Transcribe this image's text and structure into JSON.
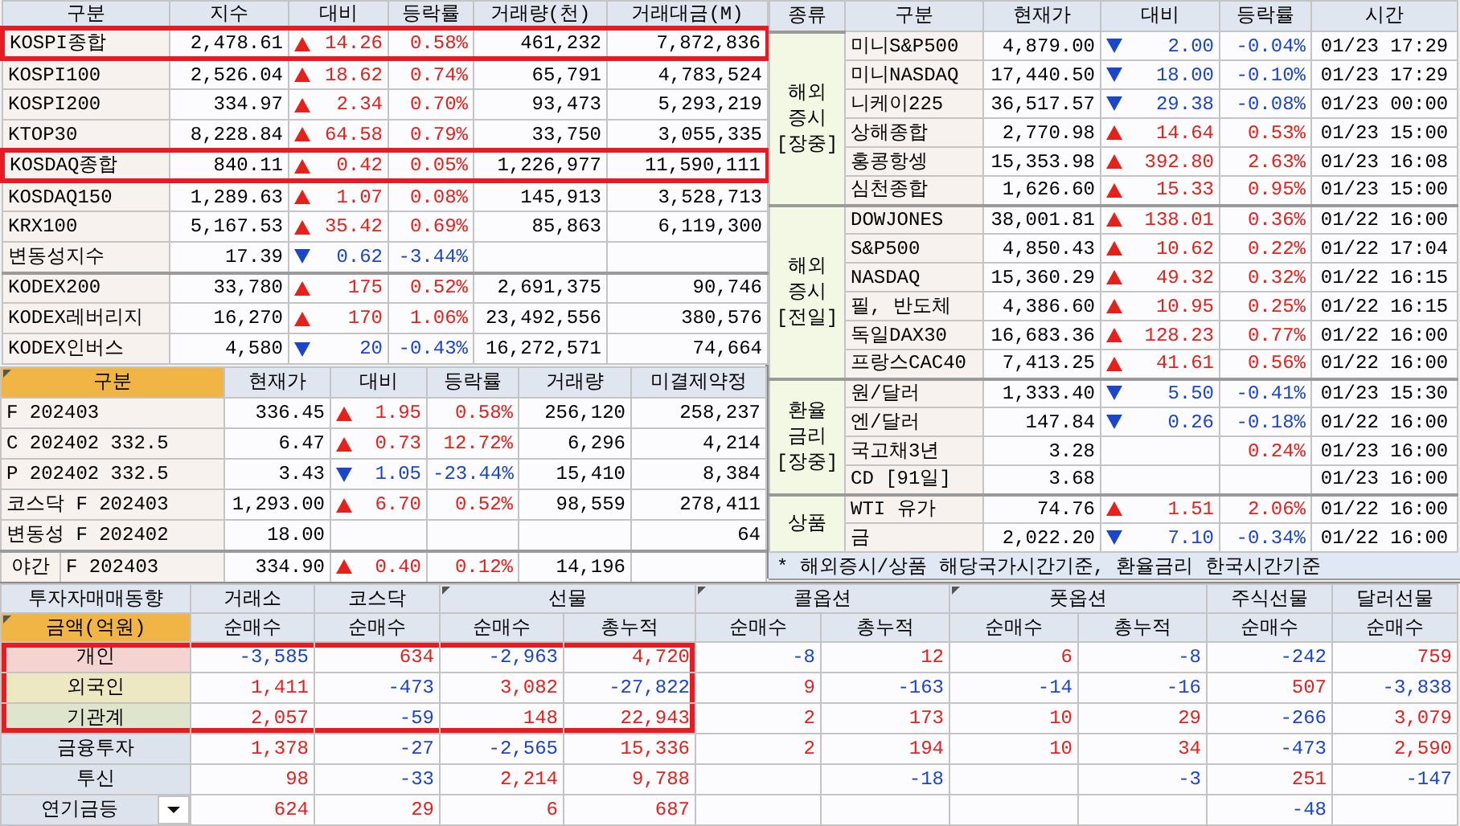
{
  "index_table": {
    "columns": [
      "구분",
      "지수",
      "대비",
      "등락률",
      "거래량(천)",
      "거래대금(M)"
    ],
    "index_rows": [
      {
        "name": "KOSPI종합",
        "value": "2,478.61",
        "up": true,
        "change": "14.26",
        "rate": "0.58%",
        "volume": "461,232",
        "amount": "7,872,836",
        "highlighted": true
      },
      {
        "name": "KOSPI100",
        "value": "2,526.04",
        "up": true,
        "change": "18.62",
        "rate": "0.74%",
        "volume": "65,791",
        "amount": "4,783,524",
        "highlighted": false
      },
      {
        "name": "KOSPI200",
        "value": "334.97",
        "up": true,
        "change": "2.34",
        "rate": "0.70%",
        "volume": "93,473",
        "amount": "5,293,219",
        "highlighted": false
      },
      {
        "name": "KTOP30",
        "value": "8,228.84",
        "up": true,
        "change": "64.58",
        "rate": "0.79%",
        "volume": "33,750",
        "amount": "3,055,335",
        "highlighted": false
      },
      {
        "name": "KOSDAQ종합",
        "value": "840.11",
        "up": true,
        "change": "0.42",
        "rate": "0.05%",
        "volume": "1,226,977",
        "amount": "11,590,111",
        "highlighted": true
      },
      {
        "name": "KOSDAQ150",
        "value": "1,289.63",
        "up": true,
        "change": "1.07",
        "rate": "0.08%",
        "volume": "145,913",
        "amount": "3,528,713",
        "highlighted": false
      },
      {
        "name": "KRX100",
        "value": "5,167.53",
        "up": true,
        "change": "35.42",
        "rate": "0.69%",
        "volume": "85,863",
        "amount": "6,119,300",
        "highlighted": false
      },
      {
        "name": "변동성지수",
        "value": "17.39",
        "up": false,
        "change": "0.62",
        "rate": "-3.44%",
        "highlighted": false
      }
    ],
    "etf_rows": [
      {
        "name": "KODEX200",
        "value": "33,780",
        "up": true,
        "change": "175",
        "rate": "0.52%",
        "volume": "2,691,375",
        "amount": "90,746"
      },
      {
        "name": "KODEX레버리지",
        "value": "16,270",
        "up": true,
        "change": "170",
        "rate": "1.06%",
        "volume": "23,492,556",
        "amount": "380,576"
      },
      {
        "name": "KODEX인버스",
        "value": "4,580",
        "up": false,
        "change": "20",
        "rate": "-0.43%",
        "volume": "16,272,571",
        "amount": "74,664"
      }
    ]
  },
  "futures_table": {
    "columns": [
      "구분",
      "현재가",
      "대비",
      "등락률",
      "거래량",
      "미결제약정"
    ],
    "rows": [
      {
        "name": "F 202403",
        "value": "336.45",
        "up": true,
        "change": "1.95",
        "rate": "0.58%",
        "volume": "256,120",
        "open_interest": "258,237"
      },
      {
        "name": "C 202402 332.5",
        "value": "6.47",
        "up": true,
        "change": "0.73",
        "rate": "12.72%",
        "volume": "6,296",
        "open_interest": "4,214"
      },
      {
        "name": "P 202402 332.5",
        "value": "3.43",
        "up": false,
        "change": "1.05",
        "rate": "-23.44%",
        "volume": "15,410",
        "open_interest": "8,384"
      },
      {
        "name": "코스닥 F 202403",
        "value": "1,293.00",
        "up": true,
        "change": "6.70",
        "rate": "0.52%",
        "volume": "98,559",
        "open_interest": "278,411"
      },
      {
        "name": "변동성 F 202402",
        "value": "18.00",
        "open_interest": "64"
      },
      {
        "session": "야간",
        "name": "F 202403",
        "value": "334.90",
        "up": true,
        "change": "0.40",
        "rate": "0.12%",
        "volume": "14,196"
      }
    ]
  },
  "global_table": {
    "columns": [
      "종류",
      "구분",
      "현재가",
      "대비",
      "등락률",
      "시간"
    ],
    "groups": [
      {
        "label_lines": [
          "해외",
          "증시",
          "[장중]"
        ],
        "rows": [
          {
            "name": "미니S&P500",
            "value": "4,879.00",
            "up": false,
            "change": "2.00",
            "rate": "-0.04%",
            "time": "01/23 17:29"
          },
          {
            "name": "미니NASDAQ",
            "value": "17,440.50",
            "up": false,
            "change": "18.00",
            "rate": "-0.10%",
            "time": "01/23 17:29"
          },
          {
            "name": "니케이225",
            "value": "36,517.57",
            "up": false,
            "change": "29.38",
            "rate": "-0.08%",
            "time": "01/23 00:00"
          },
          {
            "name": "상해종합",
            "value": "2,770.98",
            "up": true,
            "change": "14.64",
            "rate": "0.53%",
            "time": "01/23 15:00"
          },
          {
            "name": "홍콩항셍",
            "value": "15,353.98",
            "up": true,
            "change": "392.80",
            "rate": "2.63%",
            "time": "01/23 16:08"
          },
          {
            "name": "심천종합",
            "value": "1,626.60",
            "up": true,
            "change": "15.33",
            "rate": "0.95%",
            "time": "01/23 15:00"
          }
        ]
      },
      {
        "label_lines": [
          "해외",
          "증시",
          "[전일]"
        ],
        "rows": [
          {
            "name": "DOWJONES",
            "value": "38,001.81",
            "up": true,
            "change": "138.01",
            "rate": "0.36%",
            "time": "01/22 16:00"
          },
          {
            "name": "S&P500",
            "value": "4,850.43",
            "up": true,
            "change": "10.62",
            "rate": "0.22%",
            "time": "01/22 17:04"
          },
          {
            "name": "NASDAQ",
            "value": "15,360.29",
            "up": true,
            "change": "49.32",
            "rate": "0.32%",
            "time": "01/22 16:15"
          },
          {
            "name": "필, 반도체",
            "value": "4,386.60",
            "up": true,
            "change": "10.95",
            "rate": "0.25%",
            "time": "01/22 16:15"
          },
          {
            "name": "독일DAX30",
            "value": "16,683.36",
            "up": true,
            "change": "128.23",
            "rate": "0.77%",
            "time": "01/22 16:00"
          },
          {
            "name": "프랑스CAC40",
            "value": "7,413.25",
            "up": true,
            "change": "41.61",
            "rate": "0.56%",
            "time": "01/22 16:00"
          }
        ]
      },
      {
        "label_lines": [
          "환율",
          "금리",
          "[장중]"
        ],
        "rows": [
          {
            "name": "원/달러",
            "value": "1,333.40",
            "up": false,
            "change": "5.50",
            "rate": "-0.41%",
            "time": "01/23 15:30"
          },
          {
            "name": "엔/달러",
            "value": "147.84",
            "up": false,
            "change": "0.26",
            "rate": "-0.18%",
            "time": "01/22 16:00"
          },
          {
            "name": "국고채3년",
            "value": "3.28",
            "up": true,
            "rate": "0.24%",
            "time": "01/23 16:00"
          },
          {
            "name": "CD [91일]",
            "value": "3.68",
            "time": "01/23 16:00"
          }
        ]
      },
      {
        "label_lines": [
          "상품"
        ],
        "rows": [
          {
            "name": "WTI 유가",
            "value": "74.76",
            "up": true,
            "change": "1.51",
            "rate": "2.06%",
            "time": "01/22 16:00"
          },
          {
            "name": "금",
            "value": "2,022.20",
            "up": false,
            "change": "7.10",
            "rate": "-0.34%",
            "time": "01/22 16:00"
          }
        ]
      }
    ],
    "footnote": "* 해외증시/상품 해당국가시간기준, 환율금리 한국시간기준"
  },
  "investor_table": {
    "title": "투자자매매동향",
    "unit": "금액(억원)",
    "groups": [
      {
        "label": "거래소",
        "marked": false,
        "sub": [
          "순매수"
        ]
      },
      {
        "label": "코스닥",
        "marked": false,
        "sub": [
          "순매수"
        ]
      },
      {
        "label": "선물",
        "marked": true,
        "sub": [
          "순매수",
          "총누적"
        ]
      },
      {
        "label": "콜옵션",
        "marked": true,
        "sub": [
          "순매수",
          "총누적"
        ]
      },
      {
        "label": "풋옵션",
        "marked": true,
        "sub": [
          "순매수",
          "총누적"
        ]
      },
      {
        "label": "주식선물",
        "marked": false,
        "sub": [
          "순매수"
        ]
      },
      {
        "label": "달러선물",
        "marked": false,
        "sub": [
          "순매수"
        ]
      }
    ],
    "rows": [
      {
        "label": "개인",
        "color": "#f5d3d0",
        "highlighted": true,
        "has_menu": false,
        "cells": [
          {
            "text": "-3,585",
            "down": true
          },
          {
            "text": "634",
            "down": false
          },
          {
            "text": "-2,963",
            "down": true
          },
          {
            "text": "4,720",
            "down": false
          },
          {
            "text": "-8",
            "down": true
          },
          {
            "text": "12",
            "down": false
          },
          {
            "text": "6",
            "down": false
          },
          {
            "text": "-8",
            "down": true
          },
          {
            "text": "-242",
            "down": true
          },
          {
            "text": "759",
            "down": false
          }
        ]
      },
      {
        "label": "외국인",
        "color": "#ede7c2",
        "highlighted": true,
        "has_menu": false,
        "cells": [
          {
            "text": "1,411",
            "down": false
          },
          {
            "text": "-473",
            "down": true
          },
          {
            "text": "3,082",
            "down": false
          },
          {
            "text": "-27,822",
            "down": true
          },
          {
            "text": "9",
            "down": false
          },
          {
            "text": "-163",
            "down": true
          },
          {
            "text": "-14",
            "down": true
          },
          {
            "text": "-16",
            "down": true
          },
          {
            "text": "507",
            "down": false
          },
          {
            "text": "-3,838",
            "down": true
          }
        ]
      },
      {
        "label": "기관계",
        "color": "#dee5cc",
        "highlighted": true,
        "has_menu": false,
        "cells": [
          {
            "text": "2,057",
            "down": false
          },
          {
            "text": "-59",
            "down": true
          },
          {
            "text": "148",
            "down": false
          },
          {
            "text": "22,943",
            "down": false
          },
          {
            "text": "2",
            "down": false
          },
          {
            "text": "173",
            "down": false
          },
          {
            "text": "10",
            "down": false
          },
          {
            "text": "29",
            "down": false
          },
          {
            "text": "-266",
            "down": true
          },
          {
            "text": "3,079",
            "down": false
          }
        ]
      },
      {
        "label": "금융투자",
        "color": "#dce3ec",
        "highlighted": false,
        "has_menu": false,
        "cells": [
          {
            "text": "1,378",
            "down": false
          },
          {
            "text": "-27",
            "down": true
          },
          {
            "text": "-2,565",
            "down": true
          },
          {
            "text": "15,336",
            "down": false
          },
          {
            "text": "2",
            "down": false
          },
          {
            "text": "194",
            "down": false
          },
          {
            "text": "10",
            "down": false
          },
          {
            "text": "34",
            "down": false
          },
          {
            "text": "-473",
            "down": true
          },
          {
            "text": "2,590",
            "down": false
          }
        ]
      },
      {
        "label": "투신",
        "color": "#dce3ec",
        "highlighted": false,
        "has_menu": false,
        "cells": [
          {
            "text": "98",
            "down": false
          },
          {
            "text": "-33",
            "down": true
          },
          {
            "text": "2,214",
            "down": false
          },
          {
            "text": "9,788",
            "down": false
          },
          {
            "blank": true
          },
          {
            "text": "-18",
            "down": true
          },
          {
            "blank": true
          },
          {
            "text": "-3",
            "down": true
          },
          {
            "text": "251",
            "down": false
          },
          {
            "text": "-147",
            "down": true
          }
        ]
      },
      {
        "label": "연기금등",
        "color": "#dce3ec",
        "highlighted": false,
        "has_menu": true,
        "cells": [
          {
            "text": "624",
            "down": false
          },
          {
            "text": "29",
            "down": false
          },
          {
            "text": "6",
            "down": false
          },
          {
            "text": "687",
            "down": false
          },
          {
            "blank": true
          },
          {
            "blank": true
          },
          {
            "blank": true
          },
          {
            "blank": true
          },
          {
            "text": "-48",
            "down": true
          },
          {
            "blank": true
          }
        ]
      }
    ]
  }
}
